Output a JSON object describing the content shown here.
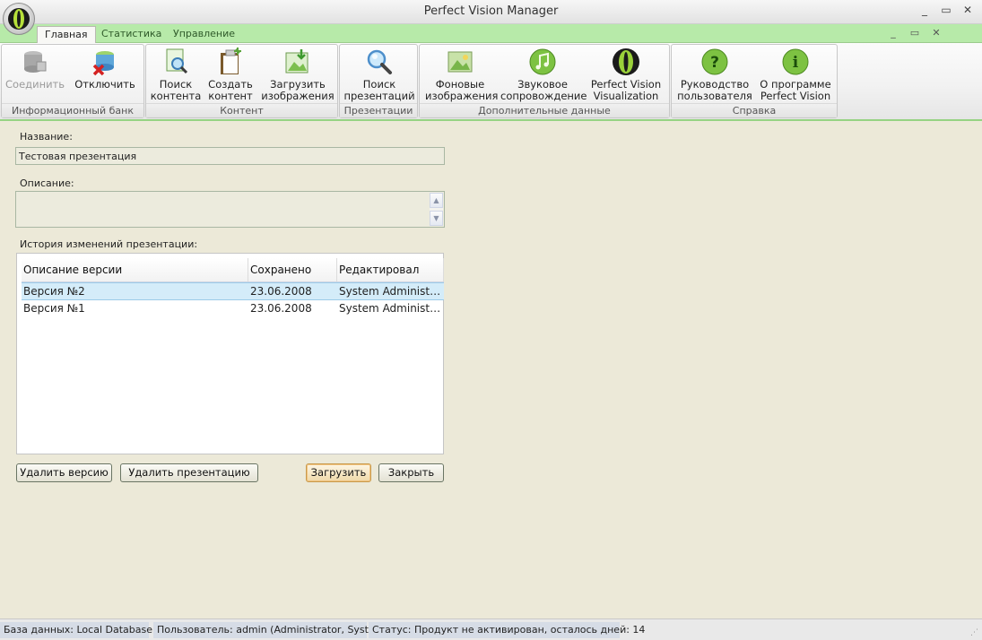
{
  "window": {
    "title": "Perfect Vision Manager",
    "controls": {
      "minimize": "_",
      "maximize": "▭",
      "close": "✕"
    }
  },
  "tabs": [
    {
      "label": "Главная",
      "active": true
    },
    {
      "label": "Статистика",
      "active": false
    },
    {
      "label": "Управление",
      "active": false
    }
  ],
  "mdi_controls": {
    "minimize": "_",
    "restore": "▭",
    "close": "✕"
  },
  "ribbon": {
    "groups": [
      {
        "label": "Информационный банк",
        "buttons": [
          {
            "label": "Соединить",
            "icon": "database-connect-icon",
            "enabled": false
          },
          {
            "label": "Отключить",
            "icon": "database-disconnect-icon",
            "enabled": true
          }
        ]
      },
      {
        "label": "Контент",
        "buttons": [
          {
            "label": "Поиск\nконтента",
            "icon": "search-content-icon",
            "enabled": true
          },
          {
            "label": "Создать\nконтент",
            "icon": "create-content-icon",
            "enabled": true
          },
          {
            "label": "Загрузить\nизображения",
            "icon": "load-images-icon",
            "enabled": true
          }
        ]
      },
      {
        "label": "Презентации",
        "buttons": [
          {
            "label": "Поиск\nпрезентаций",
            "icon": "search-presentations-icon",
            "enabled": true
          }
        ]
      },
      {
        "label": "Дополнительные данные",
        "buttons": [
          {
            "label": "Фоновые\nизображения",
            "icon": "background-images-icon",
            "enabled": true
          },
          {
            "label": "Звуковое\nсопровождение",
            "icon": "music-note-icon",
            "enabled": true
          },
          {
            "label": "Perfect Vision\nVisualization",
            "icon": "eye-logo-icon",
            "enabled": true
          }
        ]
      },
      {
        "label": "Справка",
        "buttons": [
          {
            "label": "Руководство\nпользователя",
            "icon": "help-question-icon",
            "enabled": true
          },
          {
            "label": "О программе\nPerfect Vision",
            "icon": "info-icon",
            "enabled": true
          }
        ]
      }
    ]
  },
  "form": {
    "name_label": "Название:",
    "name_value": "Тестовая презентация",
    "description_label": "Описание:",
    "description_value": "",
    "history_label": "История изменений презентации:",
    "columns": [
      "Описание версии",
      "Сохранено",
      "Редактировал"
    ],
    "rows": [
      {
        "description": "Версия №2",
        "saved": "23.06.2008",
        "editor": "System Administrat...",
        "selected": true
      },
      {
        "description": "Версия №1",
        "saved": "23.06.2008",
        "editor": "System Administrat...",
        "selected": false
      }
    ],
    "buttons": {
      "delete_version": "Удалить версию",
      "delete_presentation": "Удалить презентацию",
      "load": "Загрузить",
      "close": "Закрыть"
    }
  },
  "status": {
    "database": "База данных: Local Database",
    "user": "Пользователь: admin (Administrator, System).",
    "state": "Статус: Продукт не активирован, осталось дней: 14"
  },
  "colors": {
    "accent_green": "#b7eaa9",
    "selection": "#d4ecf9",
    "background": "#ece9d8"
  }
}
